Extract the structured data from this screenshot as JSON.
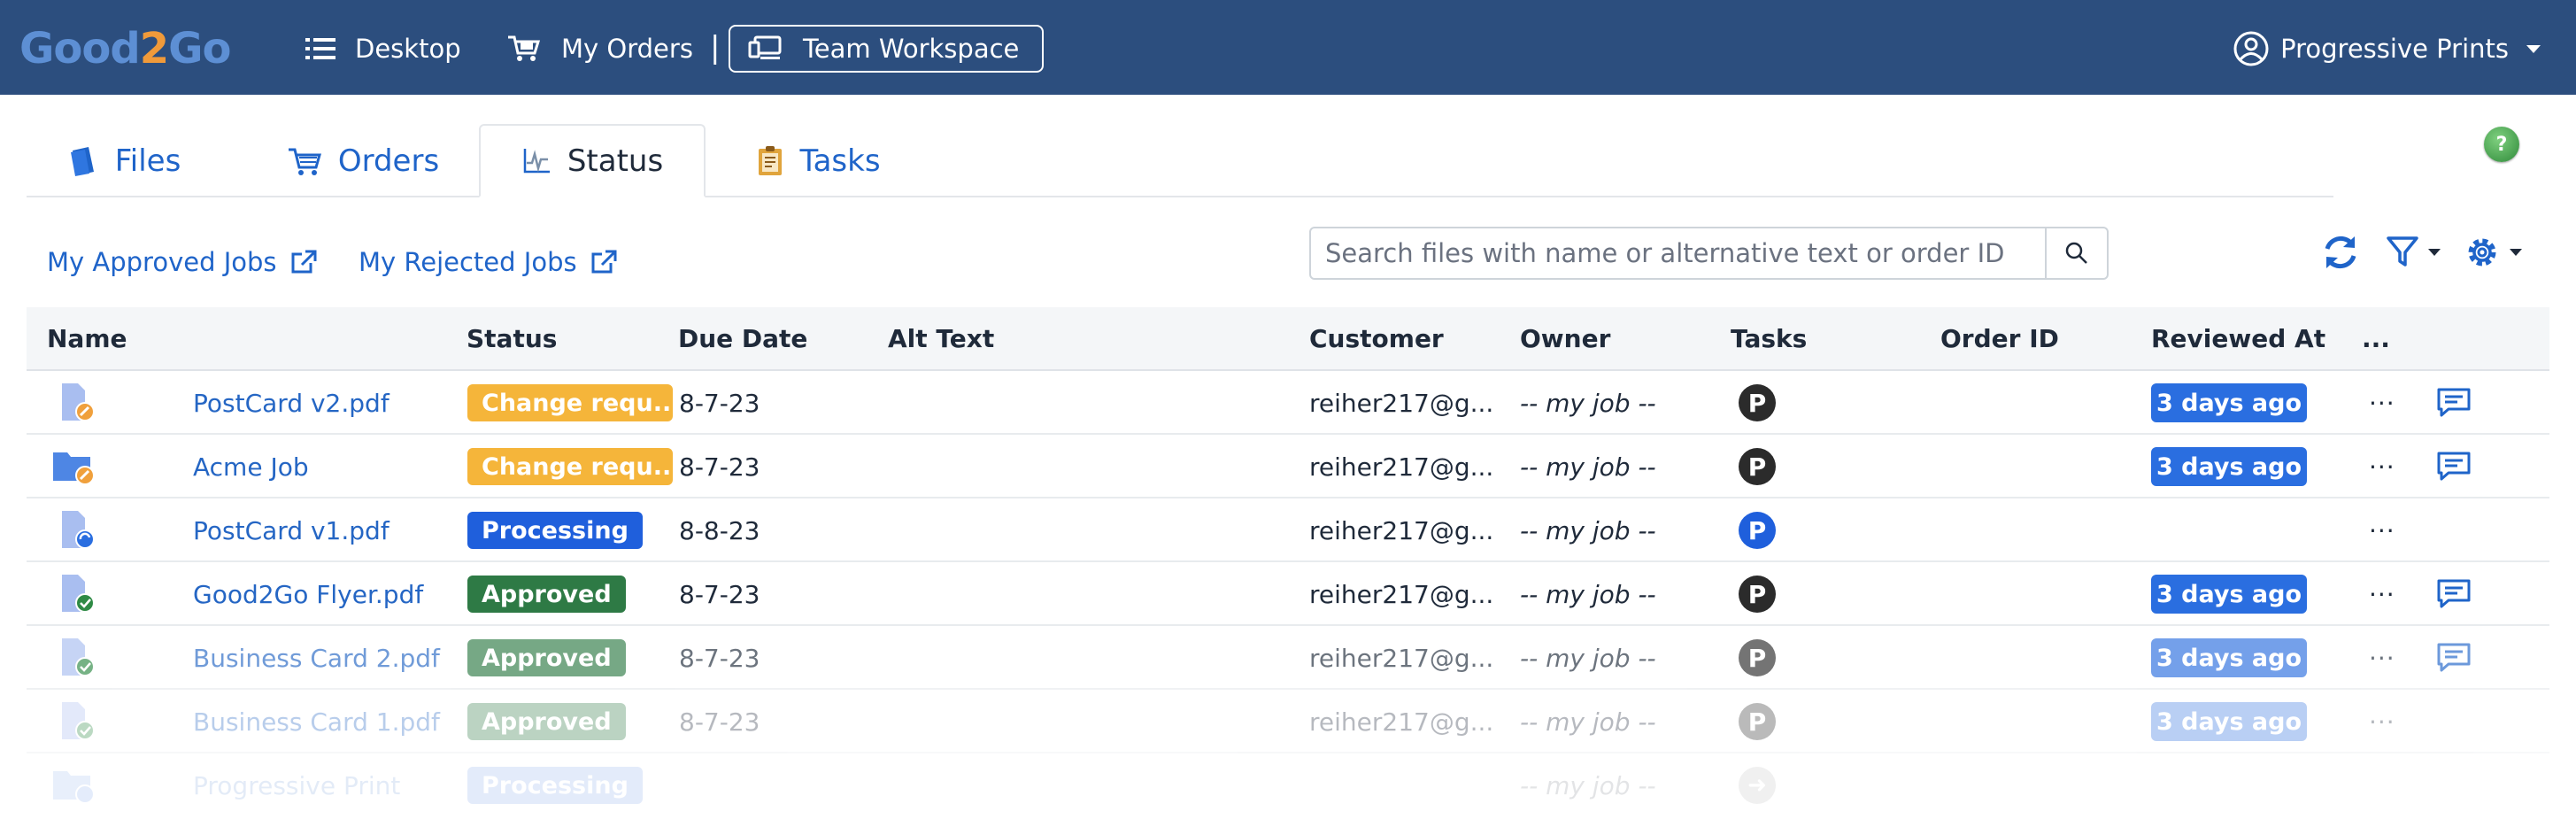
{
  "app": {
    "logo": {
      "part1": "Go",
      "part2": "od",
      "part3": "2",
      "part4": "Go"
    },
    "nav": {
      "desktop": "Desktop",
      "my_orders": "My Orders",
      "separator": "|",
      "team_workspace": "Team Workspace"
    },
    "account": {
      "name": "Progressive Prints"
    }
  },
  "tabs": [
    {
      "label": "Files",
      "active": false
    },
    {
      "label": "Orders",
      "active": false
    },
    {
      "label": "Status",
      "active": true
    },
    {
      "label": "Tasks",
      "active": false
    }
  ],
  "help": {
    "label": "?"
  },
  "toolbar": {
    "approved_link": "My Approved Jobs",
    "rejected_link": "My Rejected Jobs",
    "search_placeholder": "Search files with name or alternative text or order ID"
  },
  "table": {
    "columns": {
      "name": "Name",
      "status": "Status",
      "due_date": "Due Date",
      "alt_text": "Alt Text",
      "customer": "Customer",
      "owner": "Owner",
      "tasks": "Tasks",
      "order_id": "Order ID",
      "reviewed_at": "Reviewed At",
      "more": "..."
    },
    "rows": [
      {
        "name": "PostCard v2.pdf",
        "status": "Change requ...",
        "due": "8-7-23",
        "customer": "reiher217@g...",
        "owner": "-- my job --",
        "task": "P",
        "reviewed": "3 days ago",
        "more": "···"
      },
      {
        "name": "Acme Job",
        "status": "Change requ...",
        "due": "8-7-23",
        "customer": "reiher217@g...",
        "owner": "-- my job --",
        "task": "P",
        "reviewed": "3 days ago",
        "more": "···"
      },
      {
        "name": "PostCard v1.pdf",
        "status": "Processing",
        "due": "8-8-23",
        "customer": "reiher217@g...",
        "owner": "-- my job --",
        "task": "P",
        "reviewed": "",
        "more": "···"
      },
      {
        "name": "Good2Go Flyer.pdf",
        "status": "Approved",
        "due": "8-7-23",
        "customer": "reiher217@g...",
        "owner": "-- my job --",
        "task": "P",
        "reviewed": "3 days ago",
        "more": "···"
      },
      {
        "name": "Business Card 2.pdf",
        "status": "Approved",
        "due": "8-7-23",
        "customer": "reiher217@g...",
        "owner": "-- my job --",
        "task": "P",
        "reviewed": "3 days ago",
        "more": "···"
      },
      {
        "name": "Business Card 1.pdf",
        "status": "Approved",
        "due": "8-7-23",
        "customer": "reiher217@g...",
        "owner": "-- my job --",
        "task": "P",
        "reviewed": "3 days ago",
        "more": "···"
      },
      {
        "name": "Progressive Print",
        "status": "Processing",
        "due": "",
        "customer": "",
        "owner": "-- my job --",
        "task": "➜",
        "reviewed": "",
        "more": ""
      }
    ]
  },
  "colors": {
    "topbar": "#2c4e7e",
    "link": "#1f64c9",
    "change_requested": "#f5b53a",
    "processing": "#1f5fdc",
    "approved": "#2e7a45",
    "reviewed_badge": "#2a6ee0"
  },
  "icons": {
    "desktop": "list-icon",
    "orders": "cart-truck-icon",
    "workspace": "workspace-icon",
    "account": "user-circle-icon",
    "files_tab": "files-icon",
    "orders_tab": "cart-icon",
    "status_tab": "pulse-icon",
    "tasks_tab": "clipboard-icon",
    "external": "external-link-icon",
    "search": "search-icon",
    "refresh": "refresh-icon",
    "filter": "filter-icon",
    "settings": "gear-icon",
    "comment": "comment-icon"
  }
}
